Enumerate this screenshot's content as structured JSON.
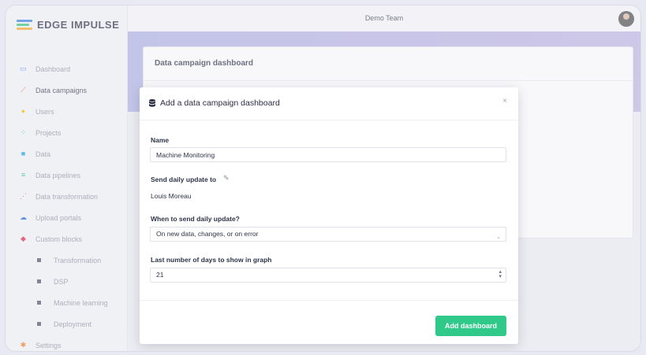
{
  "app": {
    "logo_text": "EDGE IMPULSE"
  },
  "topbar": {
    "team_name": "Demo Team"
  },
  "sidebar": {
    "items": [
      {
        "label": "Dashboard",
        "icon": "monitor-icon",
        "color": "#3b82f6"
      },
      {
        "label": "Data campaigns",
        "icon": "chart-line-icon",
        "color": "#ef4444",
        "active": true
      },
      {
        "label": "Users",
        "icon": "users-icon",
        "color": "#f5b800"
      },
      {
        "label": "Projects",
        "icon": "nodes-icon",
        "color": "#22c55e"
      },
      {
        "label": "Data",
        "icon": "database-icon",
        "color": "#0ea5e9"
      },
      {
        "label": "Data pipelines",
        "icon": "pipeline-icon",
        "color": "#10b981"
      },
      {
        "label": "Data transformation",
        "icon": "transform-icon",
        "color": "#ef4444"
      },
      {
        "label": "Upload portals",
        "icon": "cloud-upload-icon",
        "color": "#2563eb"
      },
      {
        "label": "Custom blocks",
        "icon": "cube-icon",
        "color": "#e11d48"
      },
      {
        "label": "Transformation",
        "icon": "square-icon",
        "sub": true
      },
      {
        "label": "DSP",
        "icon": "square-icon",
        "sub": true
      },
      {
        "label": "Machine learning",
        "icon": "square-icon",
        "sub": true
      },
      {
        "label": "Deployment",
        "icon": "square-icon",
        "sub": true
      },
      {
        "label": "Settings",
        "icon": "gear-icon",
        "color": "#f97316"
      }
    ]
  },
  "background_card": {
    "title": "Data campaign dashboard"
  },
  "modal": {
    "title": "Add a data campaign dashboard",
    "close_label": "×",
    "name_label": "Name",
    "name_value": "Machine Monitoring",
    "send_to_label": "Send daily update to",
    "send_to_value": "Louis Moreau",
    "when_label": "When to send daily update?",
    "when_value": "On new data, changes, or on error",
    "days_label": "Last number of days to show in graph",
    "days_value": "21",
    "submit_label": "Add dashboard"
  },
  "colors": {
    "accent_green": "#2fc98a",
    "banner": "#7a7fd8"
  }
}
